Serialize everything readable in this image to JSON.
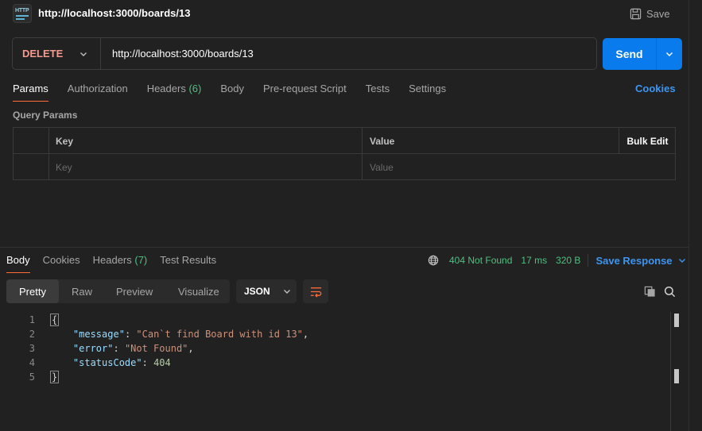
{
  "request": {
    "title": "http://localhost:3000/boards/13",
    "save_label": "Save",
    "icon_text": "HTTP",
    "method": "DELETE",
    "url": "http://localhost:3000/boards/13",
    "send_label": "Send",
    "tabs": [
      {
        "label": "Params",
        "active": true
      },
      {
        "label": "Authorization"
      },
      {
        "label": "Headers",
        "count": "(6)"
      },
      {
        "label": "Body"
      },
      {
        "label": "Pre-request Script"
      },
      {
        "label": "Tests"
      },
      {
        "label": "Settings"
      }
    ],
    "cookies_label": "Cookies",
    "query_params_label": "Query Params",
    "table": {
      "key_header": "Key",
      "value_header": "Value",
      "bulk_edit": "Bulk Edit",
      "key_placeholder": "Key",
      "value_placeholder": "Value"
    }
  },
  "response": {
    "tabs": [
      {
        "label": "Body",
        "active": true
      },
      {
        "label": "Cookies"
      },
      {
        "label": "Headers",
        "count": "(7)"
      },
      {
        "label": "Test Results"
      }
    ],
    "status": "404 Not Found",
    "time": "17 ms",
    "size": "320 B",
    "save_response": "Save Response",
    "views": [
      "Pretty",
      "Raw",
      "Preview",
      "Visualize"
    ],
    "active_view": "Pretty",
    "format": "JSON",
    "lines": [
      {
        "n": "1"
      },
      {
        "n": "2",
        "key": "\"message\"",
        "value": "\"Can`t find Board with id 13\"",
        "type": "str",
        "comma": ","
      },
      {
        "n": "3",
        "key": "\"error\"",
        "value": "\"Not Found\"",
        "type": "str",
        "comma": ","
      },
      {
        "n": "4",
        "key": "\"statusCode\"",
        "value": "404",
        "type": "num",
        "comma": ""
      },
      {
        "n": "5"
      }
    ],
    "open_brace": "{",
    "close_brace": "}"
  },
  "colors": {
    "accent_tab": "#ff6c37",
    "send": "#097bed",
    "status_ok": "#4fc07f",
    "link": "#3e95f0",
    "method_delete": "#f79a8e"
  },
  "icons": [
    "http-icon",
    "save-icon",
    "chevron-down-icon",
    "globe-icon",
    "wrap-lines-icon",
    "copy-icon",
    "search-icon"
  ]
}
